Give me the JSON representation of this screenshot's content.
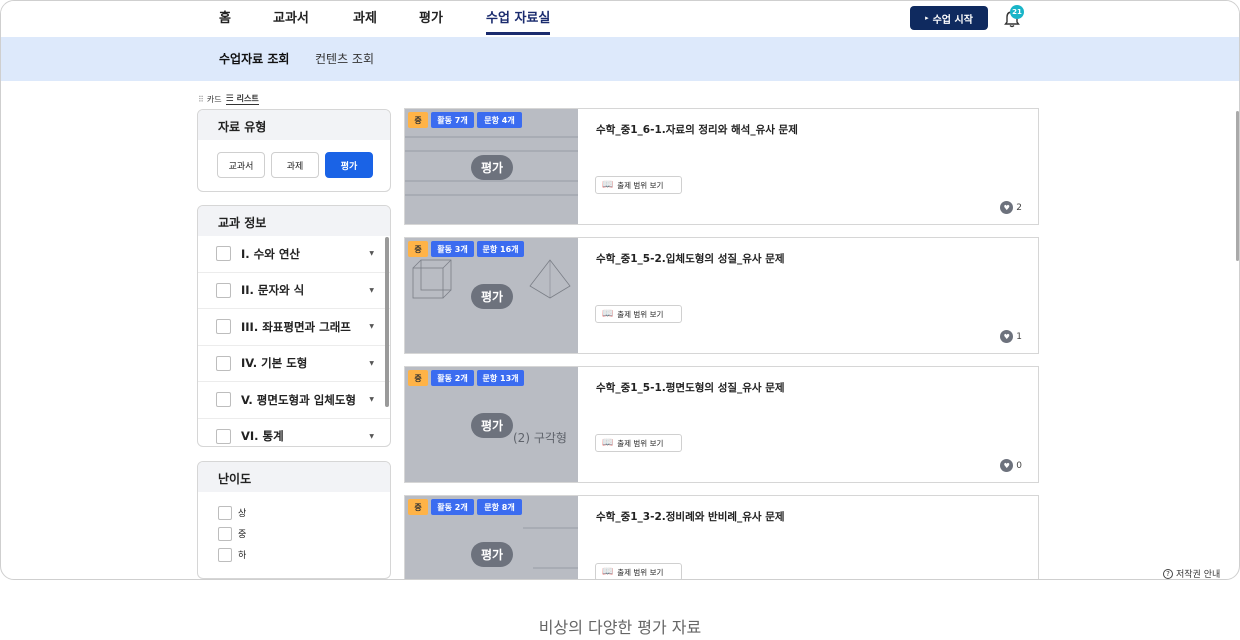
{
  "top_nav": {
    "items": [
      "홈",
      "교과서",
      "과제",
      "평가",
      "수업 자료실"
    ],
    "active": "수업 자료실",
    "start_button": "수업 시작",
    "notification_count": "21"
  },
  "sub_nav": {
    "items": [
      "수업자료 조회",
      "컨텐츠 조회"
    ],
    "active": "수업자료 조회"
  },
  "view_toggle": {
    "card": "카드",
    "list": "리스트",
    "active": "리스트"
  },
  "filter_type": {
    "title": "자료 유형",
    "buttons": [
      "교과서",
      "과제",
      "평가"
    ],
    "active": "평가"
  },
  "filter_subject": {
    "title": "교과 정보",
    "units": [
      "I. 수와 연산",
      "II. 문자와 식",
      "III. 좌표평면과 그래프",
      "IV. 기본 도형",
      "V. 평면도형과 입체도형",
      "VI. 통계"
    ]
  },
  "filter_difficulty": {
    "title": "난이도",
    "levels": [
      "상",
      "중",
      "하"
    ]
  },
  "cards": [
    {
      "level": "중",
      "activities": "활동 7개",
      "questions": "문항 4개",
      "tag": "평가",
      "title": "수학_중1_6-1.자료의 정리와 해석_유사 문제",
      "range_label": "출제 범위 보기",
      "likes": "2"
    },
    {
      "level": "중",
      "activities": "활동 3개",
      "questions": "문항 16개",
      "tag": "평가",
      "title": "수학_중1_5-2.입체도형의 성질_유사 문제",
      "range_label": "출제 범위 보기",
      "likes": "1"
    },
    {
      "level": "중",
      "activities": "활동 2개",
      "questions": "문항 13개",
      "tag": "평가",
      "title": "수학_중1_5-1.평면도형의 성질_유사 문제",
      "range_label": "출제 범위 보기",
      "likes": "0"
    },
    {
      "level": "중",
      "activities": "활동 2개",
      "questions": "문항 8개",
      "tag": "평가",
      "title": "수학_중1_3-2.정비례와 반비례_유사 문제",
      "range_label": "출제 범위 보기",
      "likes": ""
    }
  ],
  "thumb_texts": {
    "card2_hint": "(2) 구각형"
  },
  "copyright": "저작권 안내",
  "caption": "비상의 다양한 평가 자료",
  "colors": {
    "primary": "#1a63e6",
    "navy": "#0f2a5f",
    "subnav_bg": "#dde9fb",
    "level_badge": "#ffb347"
  }
}
